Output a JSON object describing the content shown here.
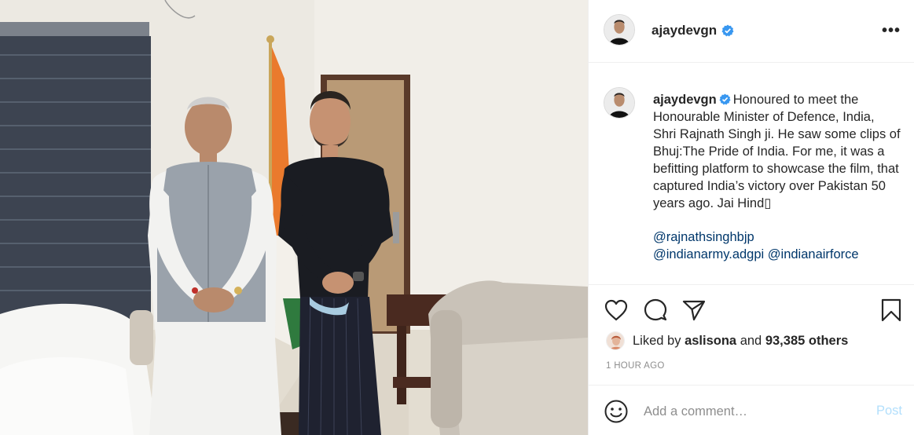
{
  "header": {
    "username": "ajaydevgn",
    "more_label": "•••"
  },
  "caption": {
    "username": "ajaydevgn",
    "text": "Honoured to meet the Honourable Minister of Defence, India, Shri Rajnath Singh ji. He saw some clips of Bhuj:The Pride of India. For me, it was a befitting platform to showcase the film, that captured India’s victory over Pakistan 50 years ago. Jai Hind▯",
    "mentions": [
      "@rajnathsinghbjp",
      "@indianarmy.adgpi",
      "@indianairforce"
    ]
  },
  "actions": {
    "like_icon": "heart-icon",
    "comment_icon": "comment-icon",
    "share_icon": "paper-plane-icon",
    "save_icon": "bookmark-icon"
  },
  "likes": {
    "prefix": "Liked by",
    "user": "aslisona",
    "connector": "and",
    "others": "93,385 others"
  },
  "timestamp": "1 HOUR AGO",
  "comment": {
    "placeholder": "Add a comment…",
    "post_label": "Post",
    "emoji_icon": "smiley-icon"
  },
  "colors": {
    "verified_blue": "#3897f0",
    "link_blue": "#00376b",
    "post_button_disabled": "#b2dffc",
    "muted_text": "#8e8e8e",
    "divider": "#efefef"
  }
}
